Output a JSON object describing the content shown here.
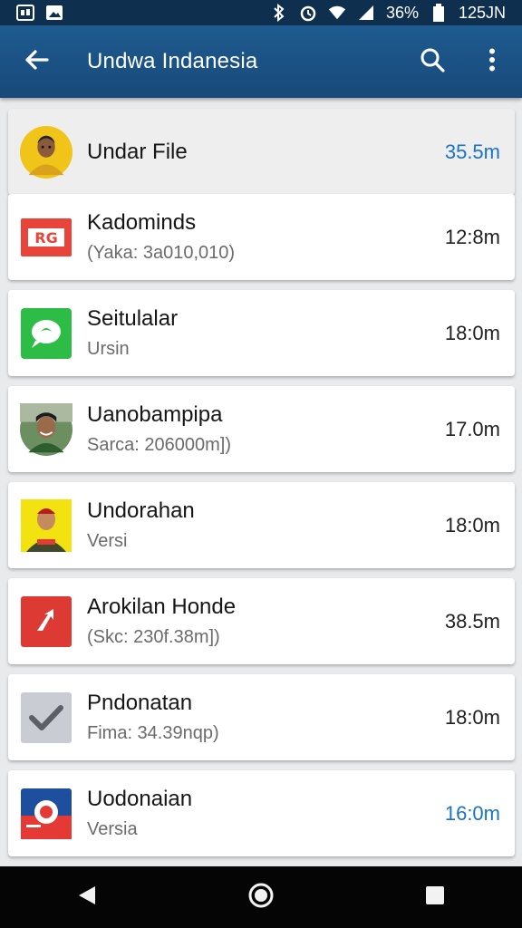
{
  "status_bar": {
    "battery": "36%",
    "time": "125JN",
    "icons": [
      "photo-icon",
      "image-icon",
      "bluetooth-icon",
      "alarm-icon",
      "wifi-icon",
      "signal-icon",
      "battery-icon"
    ]
  },
  "app_bar": {
    "title": "Undwa Indanesia",
    "icons": [
      "back-arrow-icon",
      "search-icon",
      "more-vert-icon"
    ]
  },
  "colors": {
    "app_bar": "#1f5b8f",
    "status_bar": "#0f2f4f",
    "accent": "#1a73c2",
    "nav_bar": "#050505"
  },
  "items": [
    {
      "name": "Undar File",
      "sub": "",
      "size": "35.5m",
      "accent": true,
      "icon": "person-avatar-icon"
    },
    {
      "name": "Kadominds",
      "sub": "(Yaka: 3a010,010)",
      "size": "12:8m",
      "accent": false,
      "icon": "red-logo-icon"
    },
    {
      "name": "Seitulalar",
      "sub": "Ursin",
      "size": "18:0m",
      "accent": false,
      "icon": "chat-bubble-icon"
    },
    {
      "name": "Uanobampipa",
      "sub": "Sarca: 206000m])",
      "size": "17.0m",
      "accent": false,
      "icon": "person-photo-icon"
    },
    {
      "name": "Undorahan",
      "sub": "Versi",
      "size": "18:0m",
      "accent": false,
      "icon": "person-yellow-icon"
    },
    {
      "name": "Arokilan Honde",
      "sub": "(Skc: 230f.38m])",
      "size": "38.5m",
      "accent": false,
      "icon": "red-arrow-icon"
    },
    {
      "name": "Pndonatan",
      "sub": "Fima: 34.39nqp)",
      "size": "18:0m",
      "accent": false,
      "icon": "checkbox-icon"
    },
    {
      "name": "Uodonaian",
      "sub": "Versia",
      "size": "16:0m",
      "accent": true,
      "icon": "camera-app-icon"
    }
  ]
}
